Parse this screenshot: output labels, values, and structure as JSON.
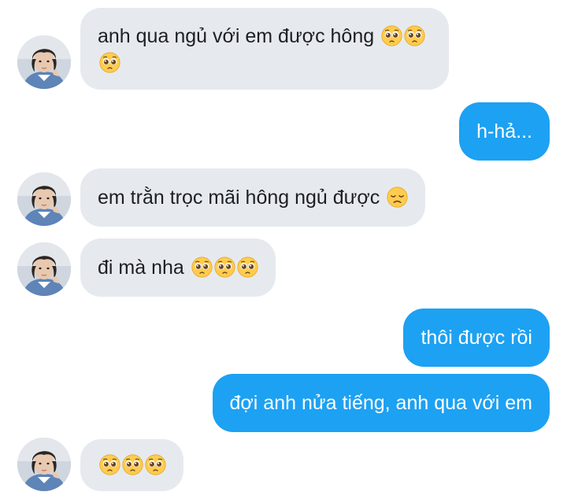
{
  "messages": [
    {
      "side": "in",
      "text": "anh qua ngủ với em được hông",
      "emoji": [
        "pleading-face-icon",
        "pleading-face-icon",
        "pleading-face-icon"
      ]
    },
    {
      "side": "out",
      "text": "h-hả...",
      "emoji": []
    },
    {
      "side": "in",
      "text": "em trằn trọc mãi hông ngủ được",
      "emoji": [
        "disappointed-face-icon"
      ]
    },
    {
      "side": "in",
      "text": "đi mà nha",
      "emoji": [
        "pleading-face-icon",
        "pleading-face-icon",
        "pleading-face-icon"
      ]
    },
    {
      "side": "out",
      "text": "thôi được rồi",
      "emoji": []
    },
    {
      "side": "out",
      "text": "đợi anh nửa tiếng, anh qua với em",
      "emoji": []
    },
    {
      "side": "in",
      "text": "",
      "emoji": [
        "pleading-face-icon",
        "pleading-face-icon",
        "pleading-face-icon"
      ]
    }
  ],
  "colors": {
    "incoming_bubble": "#e6eaef",
    "outgoing_bubble": "#1da1f2",
    "incoming_text": "#1d1f23",
    "outgoing_text": "#ffffff"
  }
}
